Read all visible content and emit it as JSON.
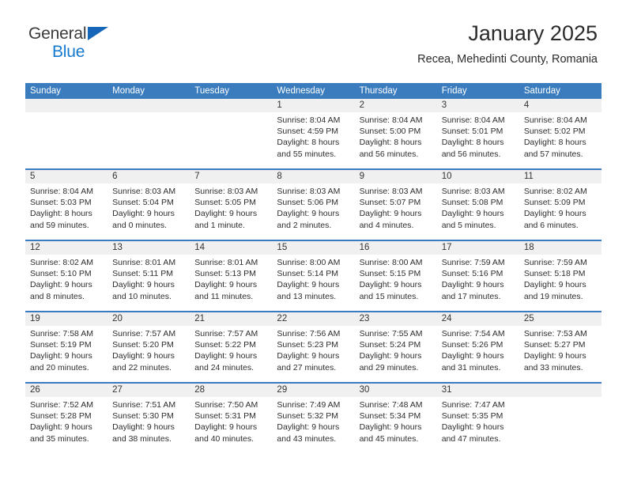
{
  "brand": {
    "line1": "General",
    "line2": "Blue",
    "triangle_color": "#1565b8",
    "blue_text_color": "#1579cf"
  },
  "header": {
    "title": "January 2025",
    "subtitle": "Recea, Mehedinti County, Romania"
  },
  "theme": {
    "header_blue": "#3a7cbe",
    "daynum_band": "#f0f0f0",
    "text": "#2d2d2d"
  },
  "labels": {
    "sunrise_prefix": "Sunrise: ",
    "sunset_prefix": "Sunset: ",
    "daylight_prefix": "Daylight: "
  },
  "weekdays": [
    "Sunday",
    "Monday",
    "Tuesday",
    "Wednesday",
    "Thursday",
    "Friday",
    "Saturday"
  ],
  "weeks": [
    [
      {
        "day": "",
        "sunrise": "",
        "sunset": "",
        "daylight_line1": "",
        "daylight_line2": ""
      },
      {
        "day": "",
        "sunrise": "",
        "sunset": "",
        "daylight_line1": "",
        "daylight_line2": ""
      },
      {
        "day": "",
        "sunrise": "",
        "sunset": "",
        "daylight_line1": "",
        "daylight_line2": ""
      },
      {
        "day": "1",
        "sunrise": "Sunrise: 8:04 AM",
        "sunset": "Sunset: 4:59 PM",
        "daylight_line1": "Daylight: 8 hours",
        "daylight_line2": "and 55 minutes."
      },
      {
        "day": "2",
        "sunrise": "Sunrise: 8:04 AM",
        "sunset": "Sunset: 5:00 PM",
        "daylight_line1": "Daylight: 8 hours",
        "daylight_line2": "and 56 minutes."
      },
      {
        "day": "3",
        "sunrise": "Sunrise: 8:04 AM",
        "sunset": "Sunset: 5:01 PM",
        "daylight_line1": "Daylight: 8 hours",
        "daylight_line2": "and 56 minutes."
      },
      {
        "day": "4",
        "sunrise": "Sunrise: 8:04 AM",
        "sunset": "Sunset: 5:02 PM",
        "daylight_line1": "Daylight: 8 hours",
        "daylight_line2": "and 57 minutes."
      }
    ],
    [
      {
        "day": "5",
        "sunrise": "Sunrise: 8:04 AM",
        "sunset": "Sunset: 5:03 PM",
        "daylight_line1": "Daylight: 8 hours",
        "daylight_line2": "and 59 minutes."
      },
      {
        "day": "6",
        "sunrise": "Sunrise: 8:03 AM",
        "sunset": "Sunset: 5:04 PM",
        "daylight_line1": "Daylight: 9 hours",
        "daylight_line2": "and 0 minutes."
      },
      {
        "day": "7",
        "sunrise": "Sunrise: 8:03 AM",
        "sunset": "Sunset: 5:05 PM",
        "daylight_line1": "Daylight: 9 hours",
        "daylight_line2": "and 1 minute."
      },
      {
        "day": "8",
        "sunrise": "Sunrise: 8:03 AM",
        "sunset": "Sunset: 5:06 PM",
        "daylight_line1": "Daylight: 9 hours",
        "daylight_line2": "and 2 minutes."
      },
      {
        "day": "9",
        "sunrise": "Sunrise: 8:03 AM",
        "sunset": "Sunset: 5:07 PM",
        "daylight_line1": "Daylight: 9 hours",
        "daylight_line2": "and 4 minutes."
      },
      {
        "day": "10",
        "sunrise": "Sunrise: 8:03 AM",
        "sunset": "Sunset: 5:08 PM",
        "daylight_line1": "Daylight: 9 hours",
        "daylight_line2": "and 5 minutes."
      },
      {
        "day": "11",
        "sunrise": "Sunrise: 8:02 AM",
        "sunset": "Sunset: 5:09 PM",
        "daylight_line1": "Daylight: 9 hours",
        "daylight_line2": "and 6 minutes."
      }
    ],
    [
      {
        "day": "12",
        "sunrise": "Sunrise: 8:02 AM",
        "sunset": "Sunset: 5:10 PM",
        "daylight_line1": "Daylight: 9 hours",
        "daylight_line2": "and 8 minutes."
      },
      {
        "day": "13",
        "sunrise": "Sunrise: 8:01 AM",
        "sunset": "Sunset: 5:11 PM",
        "daylight_line1": "Daylight: 9 hours",
        "daylight_line2": "and 10 minutes."
      },
      {
        "day": "14",
        "sunrise": "Sunrise: 8:01 AM",
        "sunset": "Sunset: 5:13 PM",
        "daylight_line1": "Daylight: 9 hours",
        "daylight_line2": "and 11 minutes."
      },
      {
        "day": "15",
        "sunrise": "Sunrise: 8:00 AM",
        "sunset": "Sunset: 5:14 PM",
        "daylight_line1": "Daylight: 9 hours",
        "daylight_line2": "and 13 minutes."
      },
      {
        "day": "16",
        "sunrise": "Sunrise: 8:00 AM",
        "sunset": "Sunset: 5:15 PM",
        "daylight_line1": "Daylight: 9 hours",
        "daylight_line2": "and 15 minutes."
      },
      {
        "day": "17",
        "sunrise": "Sunrise: 7:59 AM",
        "sunset": "Sunset: 5:16 PM",
        "daylight_line1": "Daylight: 9 hours",
        "daylight_line2": "and 17 minutes."
      },
      {
        "day": "18",
        "sunrise": "Sunrise: 7:59 AM",
        "sunset": "Sunset: 5:18 PM",
        "daylight_line1": "Daylight: 9 hours",
        "daylight_line2": "and 19 minutes."
      }
    ],
    [
      {
        "day": "19",
        "sunrise": "Sunrise: 7:58 AM",
        "sunset": "Sunset: 5:19 PM",
        "daylight_line1": "Daylight: 9 hours",
        "daylight_line2": "and 20 minutes."
      },
      {
        "day": "20",
        "sunrise": "Sunrise: 7:57 AM",
        "sunset": "Sunset: 5:20 PM",
        "daylight_line1": "Daylight: 9 hours",
        "daylight_line2": "and 22 minutes."
      },
      {
        "day": "21",
        "sunrise": "Sunrise: 7:57 AM",
        "sunset": "Sunset: 5:22 PM",
        "daylight_line1": "Daylight: 9 hours",
        "daylight_line2": "and 24 minutes."
      },
      {
        "day": "22",
        "sunrise": "Sunrise: 7:56 AM",
        "sunset": "Sunset: 5:23 PM",
        "daylight_line1": "Daylight: 9 hours",
        "daylight_line2": "and 27 minutes."
      },
      {
        "day": "23",
        "sunrise": "Sunrise: 7:55 AM",
        "sunset": "Sunset: 5:24 PM",
        "daylight_line1": "Daylight: 9 hours",
        "daylight_line2": "and 29 minutes."
      },
      {
        "day": "24",
        "sunrise": "Sunrise: 7:54 AM",
        "sunset": "Sunset: 5:26 PM",
        "daylight_line1": "Daylight: 9 hours",
        "daylight_line2": "and 31 minutes."
      },
      {
        "day": "25",
        "sunrise": "Sunrise: 7:53 AM",
        "sunset": "Sunset: 5:27 PM",
        "daylight_line1": "Daylight: 9 hours",
        "daylight_line2": "and 33 minutes."
      }
    ],
    [
      {
        "day": "26",
        "sunrise": "Sunrise: 7:52 AM",
        "sunset": "Sunset: 5:28 PM",
        "daylight_line1": "Daylight: 9 hours",
        "daylight_line2": "and 35 minutes."
      },
      {
        "day": "27",
        "sunrise": "Sunrise: 7:51 AM",
        "sunset": "Sunset: 5:30 PM",
        "daylight_line1": "Daylight: 9 hours",
        "daylight_line2": "and 38 minutes."
      },
      {
        "day": "28",
        "sunrise": "Sunrise: 7:50 AM",
        "sunset": "Sunset: 5:31 PM",
        "daylight_line1": "Daylight: 9 hours",
        "daylight_line2": "and 40 minutes."
      },
      {
        "day": "29",
        "sunrise": "Sunrise: 7:49 AM",
        "sunset": "Sunset: 5:32 PM",
        "daylight_line1": "Daylight: 9 hours",
        "daylight_line2": "and 43 minutes."
      },
      {
        "day": "30",
        "sunrise": "Sunrise: 7:48 AM",
        "sunset": "Sunset: 5:34 PM",
        "daylight_line1": "Daylight: 9 hours",
        "daylight_line2": "and 45 minutes."
      },
      {
        "day": "31",
        "sunrise": "Sunrise: 7:47 AM",
        "sunset": "Sunset: 5:35 PM",
        "daylight_line1": "Daylight: 9 hours",
        "daylight_line2": "and 47 minutes."
      },
      {
        "day": "",
        "sunrise": "",
        "sunset": "",
        "daylight_line1": "",
        "daylight_line2": ""
      }
    ]
  ]
}
